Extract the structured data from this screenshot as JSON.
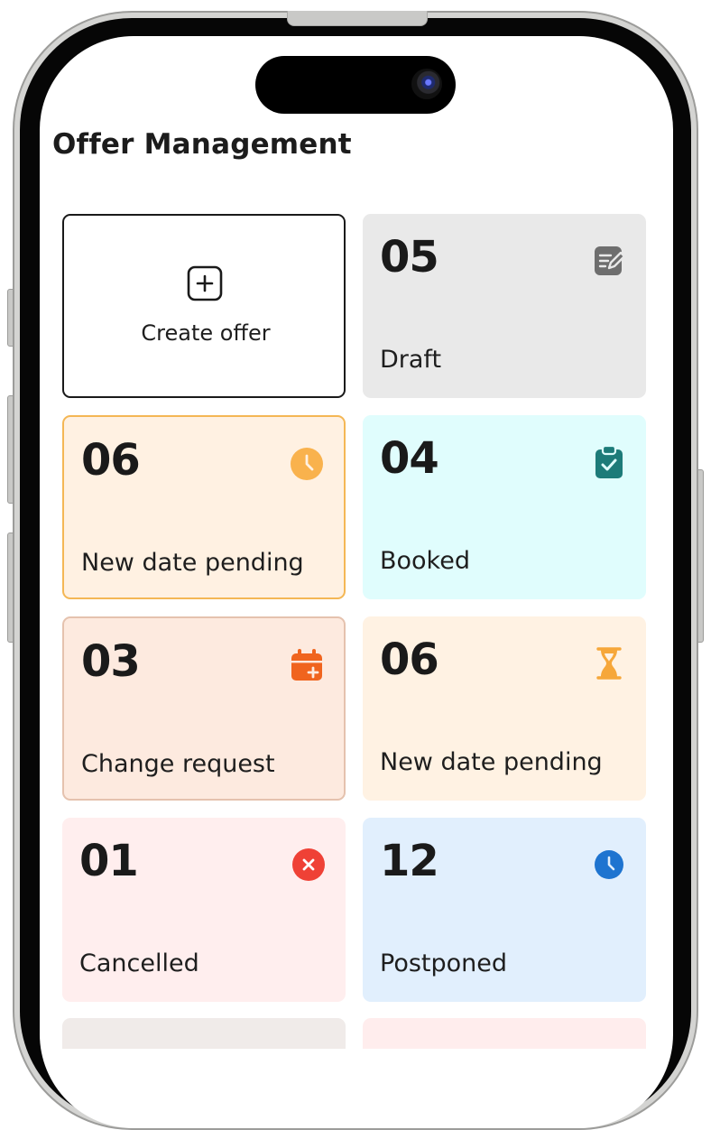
{
  "header": {
    "title": "Offer Management"
  },
  "create_card": {
    "label": "Create offer",
    "icon": "plus-square-icon"
  },
  "status_cards": [
    {
      "count": "05",
      "label": "Draft",
      "icon": "edit-note-icon",
      "accent": "#6e6e6e"
    },
    {
      "count": "06",
      "label": "New date pending",
      "icon": "clock-icon",
      "accent": "#f9b24d"
    },
    {
      "count": "04",
      "label": "Booked",
      "icon": "clipboard-check-icon",
      "accent": "#1d7b79"
    },
    {
      "count": "03",
      "label": "Change request",
      "icon": "calendar-add-icon",
      "accent": "#f0641e"
    },
    {
      "count": "06",
      "label": "New date pending",
      "icon": "hourglass-icon",
      "accent": "#f6a73a"
    },
    {
      "count": "01",
      "label": "Cancelled",
      "icon": "close-circle-icon",
      "accent": "#ef4136"
    },
    {
      "count": "12",
      "label": "Postponed",
      "icon": "clock-icon",
      "accent": "#1e74d0"
    }
  ]
}
